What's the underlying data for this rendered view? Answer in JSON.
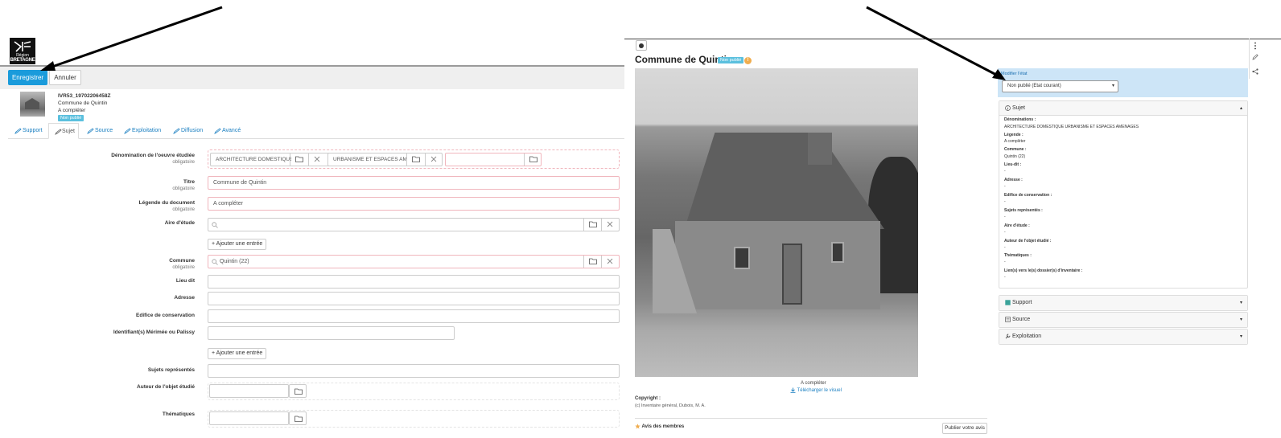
{
  "left": {
    "logo": {
      "line1": "Région",
      "line2": "BRETAGNE"
    },
    "toolbar": {
      "save_label": "Enregistrer",
      "cancel_label": "Annuler"
    },
    "record": {
      "id": "IVR53_19702206458Z",
      "title": "Commune de Quintin",
      "legend": "A compléter",
      "status": "Non publié"
    },
    "tabs": [
      "Support",
      "Sujet",
      "Source",
      "Exploitation",
      "Diffusion",
      "Avancé"
    ],
    "active_tab": "Sujet",
    "form": {
      "required_text": "obligatoire",
      "denomination": {
        "label": "Dénomination de l'oeuvre étudiée",
        "chips": [
          "ARCHITECTURE DOMESTIQUE",
          "URBANISME ET ESPACES AMENAGES"
        ]
      },
      "titre": {
        "label": "Titre",
        "value": "Commune de Quintin"
      },
      "legende": {
        "label": "Légende du document",
        "value": "A compléter"
      },
      "aire": {
        "label": "Aire d'étude",
        "value": ""
      },
      "add_entry": "Ajouter une entrée",
      "commune": {
        "label": "Commune",
        "value": "Quintin (22)"
      },
      "lieu_dit": {
        "label": "Lieu dit",
        "value": ""
      },
      "adresse": {
        "label": "Adresse",
        "value": ""
      },
      "edifice": {
        "label": "Edifice de conservation",
        "value": ""
      },
      "identifiant": {
        "label": "Identifiant(s) Mérimée ou Palissy",
        "value": ""
      },
      "sujets": {
        "label": "Sujets représentés",
        "value": ""
      },
      "auteur": {
        "label": "Auteur de l'objet étudié",
        "value": ""
      },
      "thematiques": {
        "label": "Thématiques",
        "value": ""
      }
    }
  },
  "right": {
    "title": "Commune de Quintin",
    "status": "Non publié",
    "caption": "A compléter",
    "download": "Télécharger le visuel",
    "copyright_label": "Copyright :",
    "copyright_value": "(c) Inventaire général, Dubois, M. A.",
    "avis": "Avis des membres",
    "publier": "Publier votre avis",
    "state": {
      "label": "Modifier l'état",
      "value": "Non publié (Etat courant)"
    },
    "sujet_panel": {
      "title": "Sujet",
      "fields": [
        {
          "k": "Dénominations :",
          "v": "ARCHITECTURE DOMESTIQUE URBANISME ET ESPACES AMENAGES"
        },
        {
          "k": "Légende :",
          "v": "A compléter"
        },
        {
          "k": "Commune :",
          "v": "Quintin (22)"
        },
        {
          "k": "Lieu-dit :",
          "v": "-"
        },
        {
          "k": "Adresse :",
          "v": "-"
        },
        {
          "k": "Edifice de conservation :",
          "v": "-"
        },
        {
          "k": "Sujets représentés :",
          "v": "-"
        },
        {
          "k": "Aire d'étude :",
          "v": "-"
        },
        {
          "k": "Auteur de l'objet étudié :",
          "v": "-"
        },
        {
          "k": "Thématiques :",
          "v": "-"
        },
        {
          "k": "Lien(s) vers le(s) dossier(s) d'inventaire :",
          "v": "-"
        }
      ]
    },
    "panels": [
      "Support",
      "Source",
      "Exploitation"
    ]
  },
  "icons": {
    "folder": "folder-icon",
    "clear": "close-icon",
    "search": "search-icon",
    "pencil": "pencil-icon",
    "download": "download-icon",
    "star": "star-icon",
    "info": "info-icon",
    "share": "share-icon",
    "kebab": "kebab-menu-icon",
    "wrench": "wrench-icon",
    "arrow": "annotation-arrow"
  },
  "colors": {
    "primary": "#1a9bdb",
    "badge": "#5bc0de",
    "link": "#1a7fc1",
    "state_bg": "#cde5f7"
  }
}
